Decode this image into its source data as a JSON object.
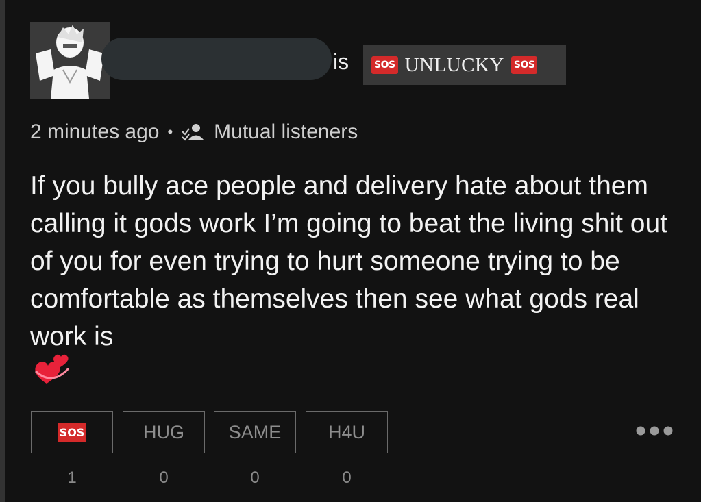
{
  "post": {
    "username": "",
    "is_label": "is",
    "mood": {
      "label": "UNLUCKY",
      "badge": "SOS"
    },
    "time": "2 minutes ago",
    "separator": "•",
    "audience": "Mutual listeners",
    "text": "If you bully ace people and delivery hate about them calling it gods work I’m going to beat the living shit out of you for even trying to hurt someone trying to be comfortable as themselves then see what gods real work is",
    "emoji": "revolving-hearts"
  },
  "reactions": [
    {
      "label": "SOS",
      "count": "1"
    },
    {
      "label": "HUG",
      "count": "0"
    },
    {
      "label": "SAME",
      "count": "0"
    },
    {
      "label": "H4U",
      "count": "0"
    }
  ],
  "colors": {
    "background": "#121212",
    "badge_red": "#d42a2a",
    "mood_bg": "#383838"
  },
  "icons": [
    "avatar",
    "people-icon",
    "revolving-hearts-emoji",
    "more-icon"
  ]
}
